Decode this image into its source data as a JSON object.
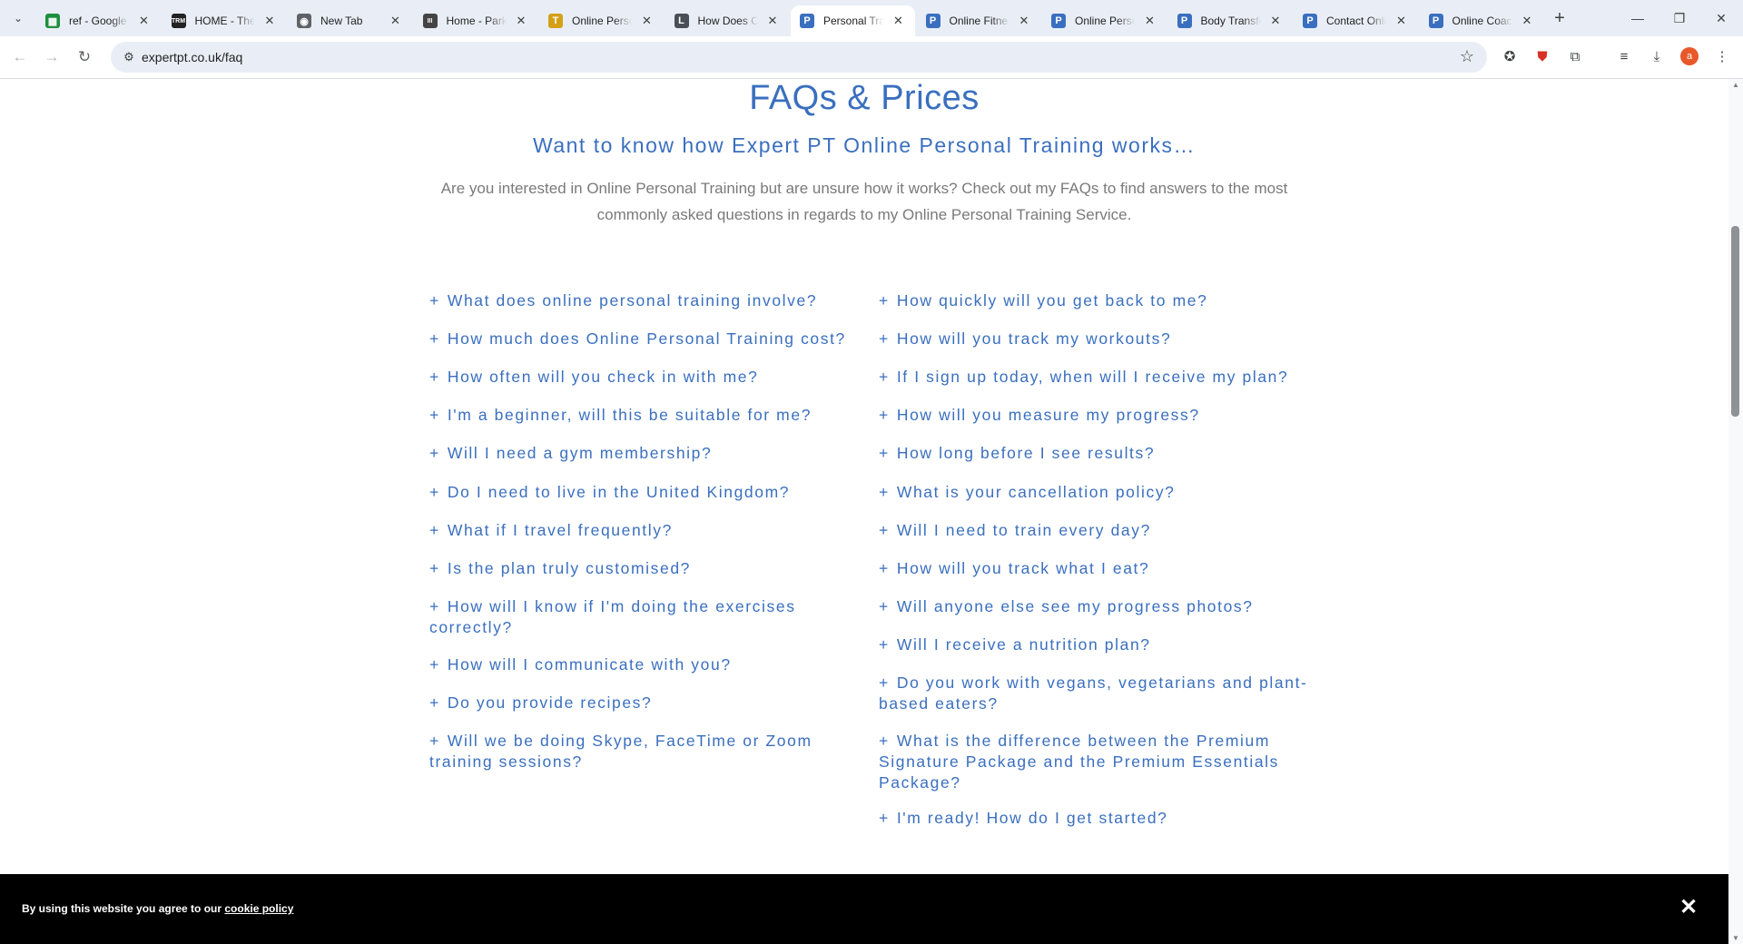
{
  "browser": {
    "tabs": [
      {
        "title": "ref - Google Sheets",
        "favicon": "sheets-icon",
        "color": "#1e8e3e",
        "glyph": "▦"
      },
      {
        "title": "HOME - The",
        "favicon": "trm-icon",
        "color": "#222222",
        "glyph": "TRM"
      },
      {
        "title": "New Tab",
        "favicon": "chrome-icon",
        "color": "#5f6368",
        "glyph": "◉"
      },
      {
        "title": "Home - Park",
        "favicon": "park-icon",
        "color": "#444444",
        "glyph": "III"
      },
      {
        "title": "Online Perso",
        "favicon": "fitness-icon",
        "color": "#d4a017",
        "glyph": "T"
      },
      {
        "title": "How Does O",
        "favicon": "l-icon",
        "color": "#4a4f57",
        "glyph": "L"
      },
      {
        "title": "Personal Tra",
        "favicon": "expertpt-icon",
        "color": "#3a6fbf",
        "glyph": "P",
        "active": true
      },
      {
        "title": "Online Fitne",
        "favicon": "expertpt-icon",
        "color": "#3a6fbf",
        "glyph": "P"
      },
      {
        "title": "Online Perso",
        "favicon": "expertpt-icon",
        "color": "#3a6fbf",
        "glyph": "P"
      },
      {
        "title": "Body Transfo",
        "favicon": "expertpt-icon",
        "color": "#3a6fbf",
        "glyph": "P"
      },
      {
        "title": "Contact Onli",
        "favicon": "expertpt-icon",
        "color": "#3a6fbf",
        "glyph": "P"
      },
      {
        "title": "Online Coac",
        "favicon": "expertpt-icon",
        "color": "#3a6fbf",
        "glyph": "P"
      }
    ],
    "url": "expertpt.co.uk/faq"
  },
  "page": {
    "title": "FAQs & Prices",
    "subtitle": "Want to know how Expert PT Online Personal Training works…",
    "intro": "Are you interested in Online Personal Training but are unsure how it works? Check out my FAQs to find answers to the most commonly asked questions in regards to my Online Personal Training Service.",
    "accent_color": "#3a6fbf",
    "faq_left": [
      "What does online personal training involve?",
      "How much does Online Personal Training cost?",
      "How often will you check in with me?",
      "I'm a beginner, will this be suitable for me?",
      "Will I need a gym membership?",
      "Do I need to live in the United Kingdom?",
      "What if I travel frequently?",
      "Is the plan truly customised?",
      "How will I know if I'm doing the exercises correctly?",
      "How will I communicate with you?",
      "Do you provide recipes?",
      "Will we be doing Skype, FaceTime or Zoom training sessions?"
    ],
    "faq_right": [
      "How quickly will you get back to me?",
      "How will you track my workouts?",
      "If I sign up today, when will I receive my plan?",
      "How will you measure my progress?",
      "How long before I see results?",
      "What is your cancellation policy?",
      "Will I need to train every day?",
      "How will you track what I eat?",
      "Will anyone else see my progress photos?",
      "Will I receive a nutrition plan?",
      "Do you work with vegans, vegetarians and plant-based eaters?",
      "What is the difference between the Premium Signature Package and the Premium Essentials Package?",
      "I'm ready! How do I get started?"
    ],
    "plus": "+"
  },
  "cookie": {
    "text": "By using this website you agree to our ",
    "link": "cookie policy",
    "close": "✕"
  }
}
